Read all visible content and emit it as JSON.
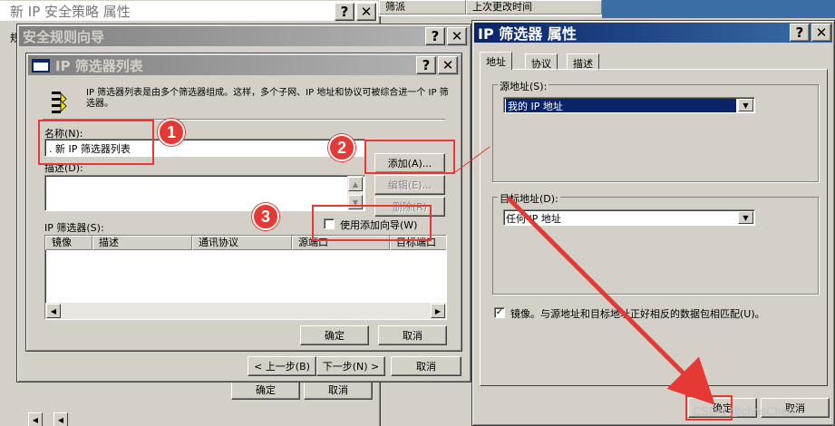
{
  "bg_window": {
    "title": "新 IP 安全策略 属性",
    "side_char": "规",
    "col_header_1": "筛",
    "col_header_2": "上次更改时间",
    "ok": "确定",
    "cancel": "取消"
  },
  "wizard": {
    "title": "安全规则向导",
    "back": "< 上一步(B)",
    "next": "下一步(N) >",
    "cancel": "取消"
  },
  "filter_list": {
    "title": "IP 筛选器列表",
    "intro": "IP 筛选器列表是由多个筛选器组成。这样，多个子网、IP 地址和协议可被综合进一个 IP 筛选器。",
    "name_label": "名称(N):",
    "name_value": "新 IP 筛选器列表",
    "desc_label": "描述(D):",
    "add": "添加(A)...",
    "edit": "编辑(E)...",
    "remove": "删除(R)",
    "use_wizard": "使用添加向导(W)",
    "filters_label": "IP 筛选器(S):",
    "columns": [
      "镜像",
      "描述",
      "通讯协议",
      "源端口",
      "目标端口"
    ],
    "ok": "确定",
    "cancel": "取消"
  },
  "props": {
    "title": "IP 筛选器 属性",
    "tabs": [
      "地址",
      "协议",
      "描述"
    ],
    "source_label": "源地址(S):",
    "source_value": "我的 IP 地址",
    "dest_label": "目标地址(D):",
    "dest_value": "任何 IP 地址",
    "mirror_label": "镜像。与源地址和目标地址正好相反的数据包相匹配(U)。",
    "ok": "确定",
    "cancel": "取消"
  },
  "badges": [
    "1",
    "2",
    "3"
  ],
  "watermark": "CSDN @chrisChen",
  "colors": {
    "annotation_red": "#e53935",
    "title_active": "#0a246a"
  }
}
